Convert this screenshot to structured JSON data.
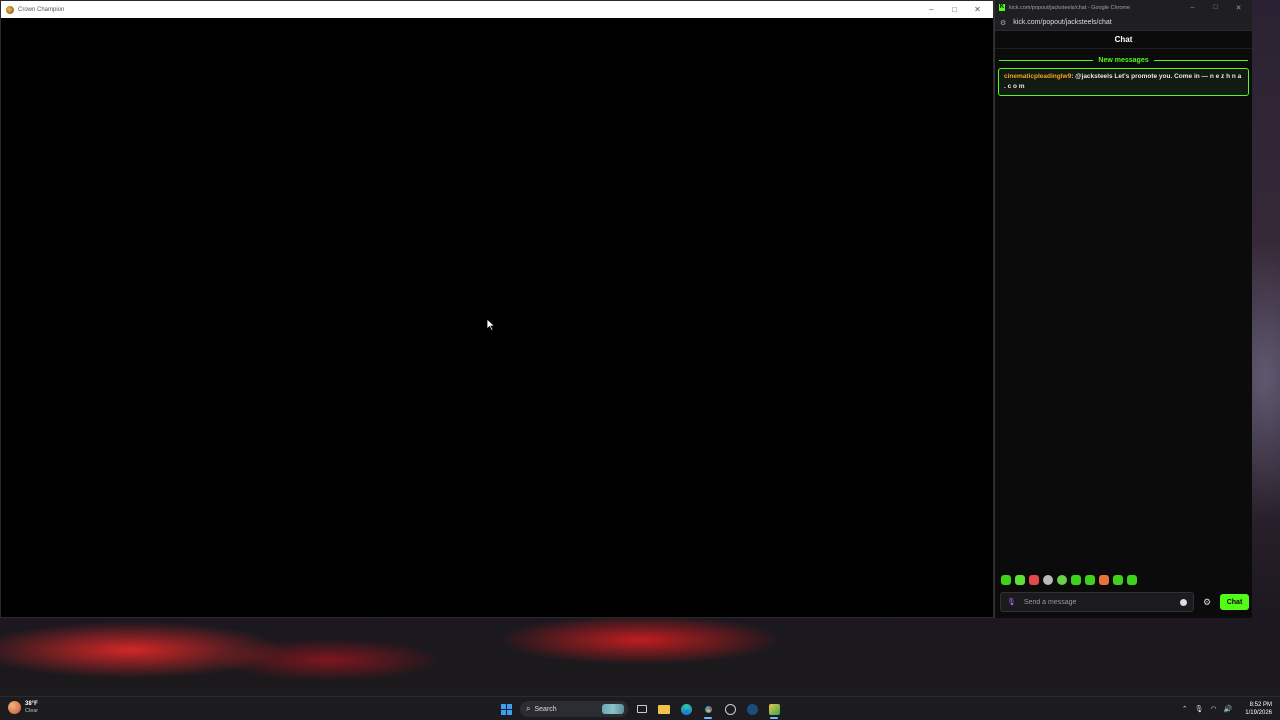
{
  "game_window": {
    "title": "Crown Champion",
    "controls": {
      "minimize": "–",
      "maximize": "□",
      "close": "✕"
    }
  },
  "chrome_window": {
    "title": "kick.com/popout/jacksteels/chat - Google Chrome",
    "url": "kick.com/popout/jacksteels/chat",
    "controls": {
      "minimize": "–",
      "maximize": "□",
      "close": "✕"
    }
  },
  "chat": {
    "title": "Chat",
    "new_messages_label": "New messages",
    "messages": [
      {
        "username": "cinematicpleadinglw9",
        "separator": ": ",
        "text": "@jacksteels Let's promote you. Come in — n e z h n a . c o m"
      }
    ],
    "input_placeholder": "Send a message",
    "send_label": "Chat",
    "emotes": [
      "emote-1",
      "emote-2",
      "emote-3",
      "emote-4",
      "emote-5",
      "emote-6",
      "emote-7",
      "emote-8",
      "emote-9",
      "emote-10"
    ]
  },
  "taskbar": {
    "weather_temp": "38°F",
    "weather_condition": "Clear",
    "search_label": "Search",
    "time": "8:52 PM",
    "date": "1/19/2026"
  },
  "colors": {
    "kick_green": "#53fc18",
    "username_color": "#f5a623"
  }
}
